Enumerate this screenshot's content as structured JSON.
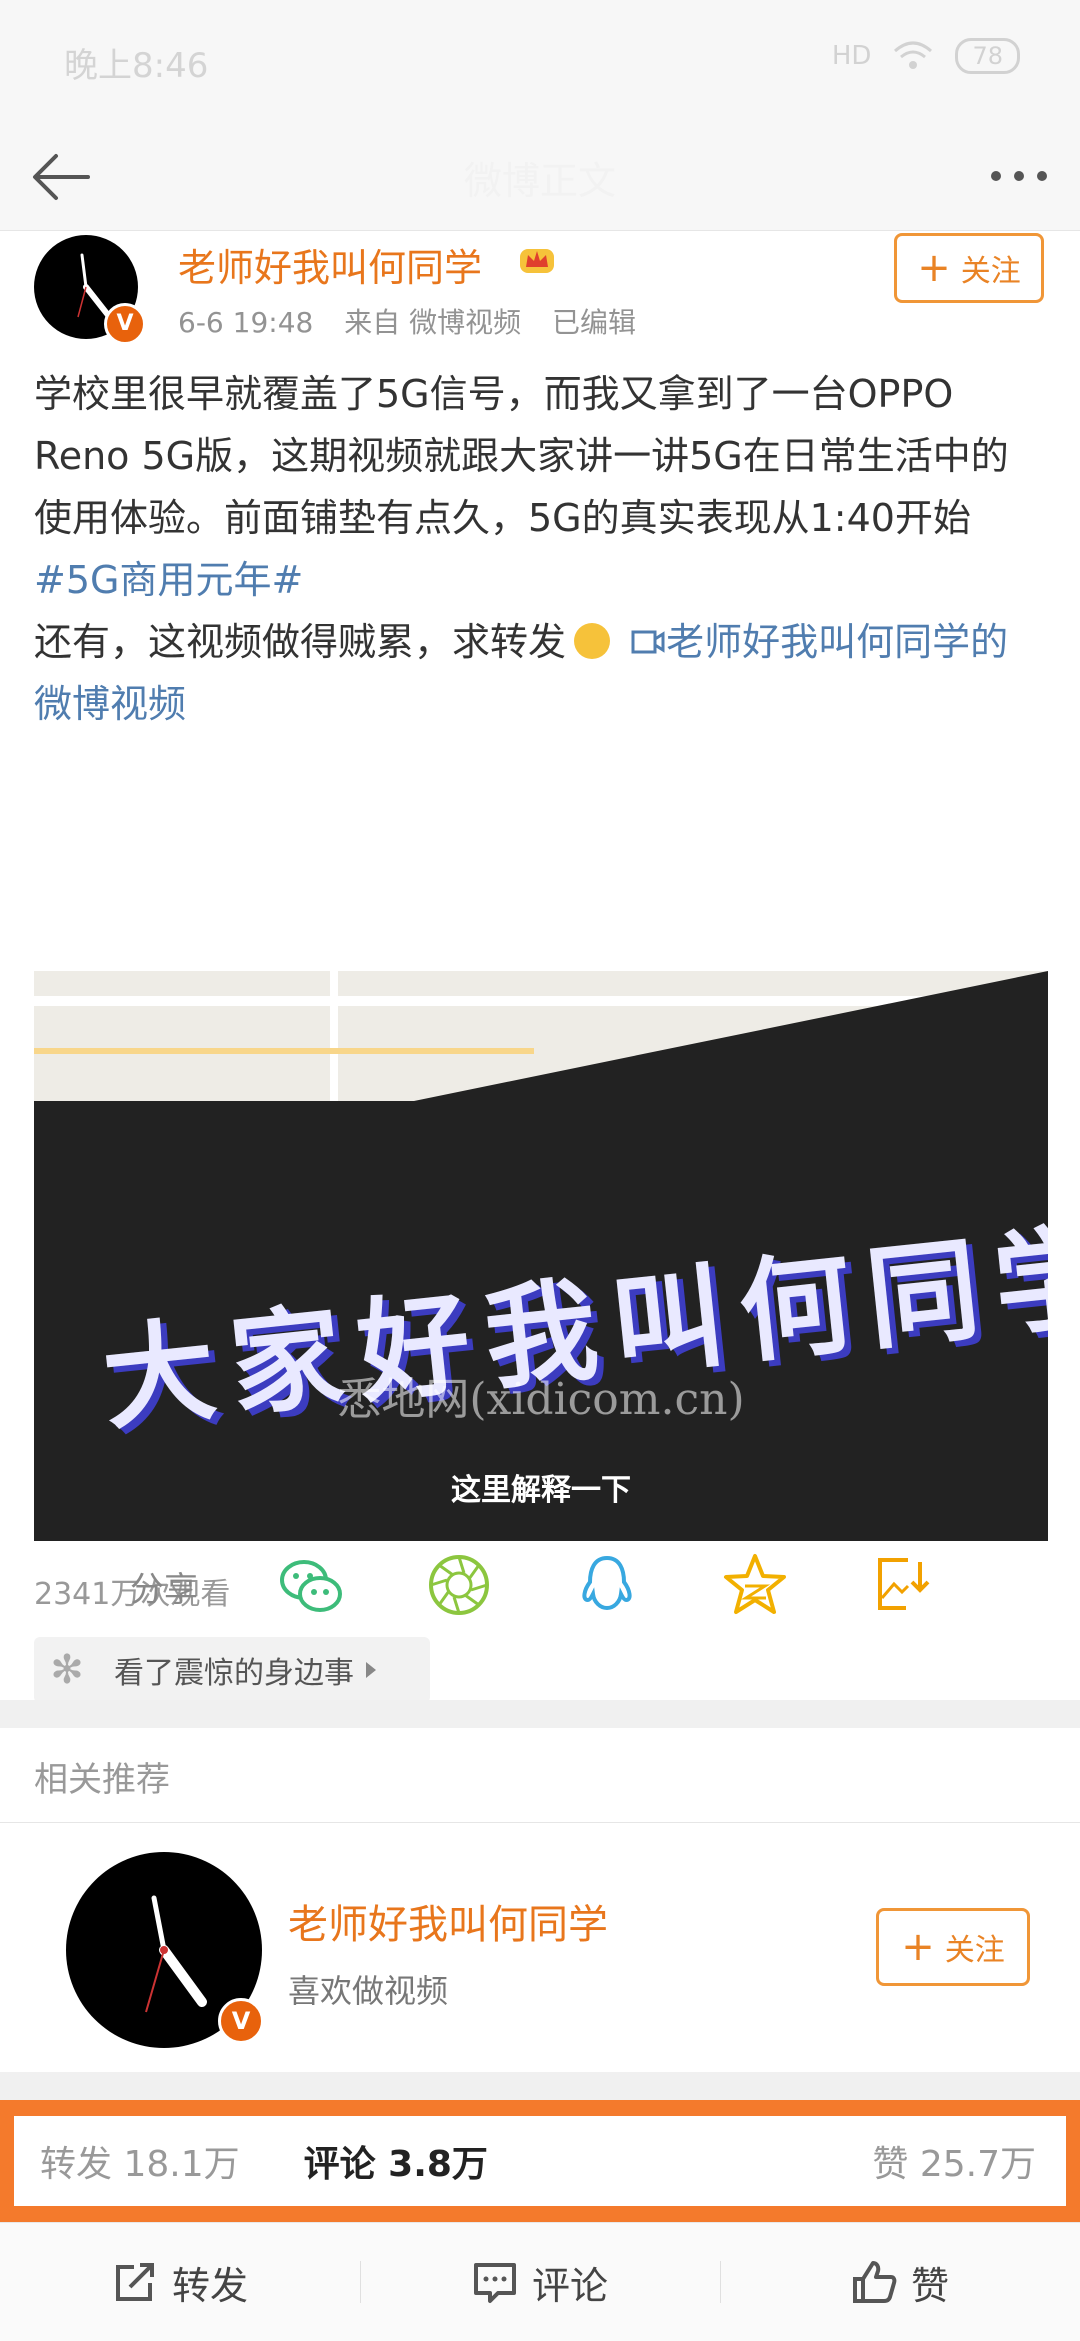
{
  "status": {
    "time": "晚上8:46",
    "network": "HD",
    "battery": "78"
  },
  "topbar": {
    "title": "微博正文"
  },
  "post": {
    "author": "老师好我叫何同学",
    "time": "6-6 19:48",
    "source": "来自 微博视频",
    "edited": "已编辑",
    "follow_label": "关注",
    "text_1": "学校里很早就覆盖了5G信号，而我又拿到了一台OPPO Reno 5G版，这期视频就跟大家讲一讲5G在日常生活中的使用体验。前面铺垫有点久，5G的真实表现从1:40开始 ",
    "hashtag": "#5G商用元年#",
    "text_2": "还有，这视频做得贼累，求转发",
    "video_link": "老师好我叫何同学的微博视频",
    "video_overlay_text": "大家好我叫何同学",
    "watermark": "悉地网(xidicom.cn)",
    "subtitle": "这里解释一下",
    "views": "2341万次观看",
    "chip_text": "看了震惊的身边事"
  },
  "share": {
    "label": "分享",
    "targets": [
      "wechat-icon",
      "moments-icon",
      "qq-icon",
      "qzone-icon",
      "save-image-icon"
    ]
  },
  "recommend": {
    "header": "相关推荐",
    "name": "老师好我叫何同学",
    "desc": "喜欢做视频",
    "follow_label": "关注"
  },
  "stats": {
    "repost": "转发 18.1万",
    "comment": "评论 3.8万",
    "like": "赞 25.7万"
  },
  "bottombar": {
    "repost": "转发",
    "comment": "评论",
    "like": "赞"
  },
  "colors": {
    "accent": "#e8761c",
    "link": "#507daf",
    "highlight": "#f47a2c"
  }
}
